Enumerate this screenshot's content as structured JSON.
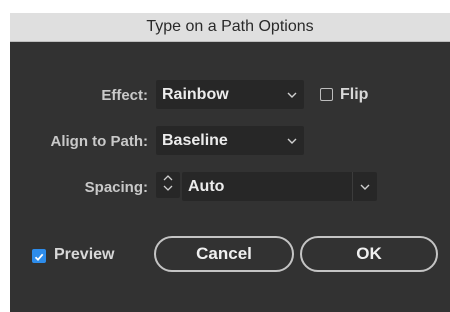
{
  "dialog": {
    "title": "Type on a Path Options"
  },
  "effect": {
    "label": "Effect:",
    "value": "Rainbow"
  },
  "flip": {
    "label": "Flip",
    "checked": false
  },
  "align": {
    "label": "Align to Path:",
    "value": "Baseline"
  },
  "spacing": {
    "label": "Spacing:",
    "value": "Auto"
  },
  "preview": {
    "label": "Preview",
    "checked": true
  },
  "buttons": {
    "cancel": "Cancel",
    "ok": "OK"
  },
  "colors": {
    "dialog_bg": "#323232",
    "titlebar_bg": "#dfdfdf",
    "field_bg": "#272727",
    "checkbox_checked": "#2d8ceb"
  },
  "icons": {
    "dropdown": "chevron-down-icon",
    "spinner": "up-down-arrows-icon",
    "check": "checkmark-icon"
  }
}
